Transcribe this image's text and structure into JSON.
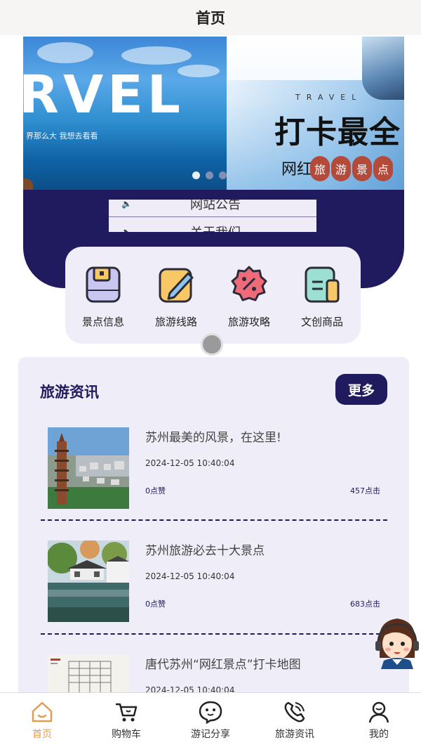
{
  "header": {
    "title": "首页"
  },
  "banner": {
    "slide1": {
      "headline": "RVEL",
      "caption": "界那么大 我想去看看"
    },
    "slide2": {
      "eyebrow": "TRAVEL",
      "title": "打卡最全",
      "prefix": "网红",
      "seal_chars": [
        "旅",
        "游",
        "景",
        "点"
      ]
    },
    "indicator_count": 3,
    "active_index": 0
  },
  "notices": [
    {
      "label": "网站公告",
      "icon": "speaker-icon"
    },
    {
      "label": "关于我们",
      "icon": "speaker-icon"
    }
  ],
  "categories": [
    {
      "label": "景点信息",
      "icon": "folder-icon",
      "color": "#c9c6f2"
    },
    {
      "label": "旅游线路",
      "icon": "pencil-note-icon",
      "color": "#f7c865"
    },
    {
      "label": "旅游攻略",
      "icon": "discount-badge-icon",
      "color": "#ef6b7a"
    },
    {
      "label": "文创商品",
      "icon": "document-icon",
      "color": "#9be0d3"
    }
  ],
  "news": {
    "section_title": "旅游资讯",
    "more_label": "更多",
    "items": [
      {
        "title": "苏州最美的风景，在这里!",
        "date": "2024-12-05 10:40:04",
        "likes": "0点赞",
        "views": "457点击",
        "thumb": "pagoda-city"
      },
      {
        "title": "苏州旅游必去十大景点",
        "date": "2024-12-05 10:40:04",
        "likes": "0点赞",
        "views": "683点击",
        "thumb": "garden-pond"
      },
      {
        "title": "唐代苏州“网红景点”打卡地图",
        "date": "2024-12-05 10:40:04",
        "likes": "",
        "views": "",
        "thumb": "old-map"
      }
    ]
  },
  "tabbar": {
    "active_index": 0,
    "active_color": "#e19e4f",
    "items": [
      {
        "label": "首页",
        "icon": "home-icon"
      },
      {
        "label": "购物车",
        "icon": "cart-icon"
      },
      {
        "label": "游记分享",
        "icon": "chat-bubble-icon"
      },
      {
        "label": "旅游资讯",
        "icon": "phone-icon"
      },
      {
        "label": "我的",
        "icon": "user-icon"
      }
    ]
  },
  "colors": {
    "primary": "#201b5e",
    "card_bg": "#efedf8",
    "topbar_bg": "#f7f5f3"
  }
}
